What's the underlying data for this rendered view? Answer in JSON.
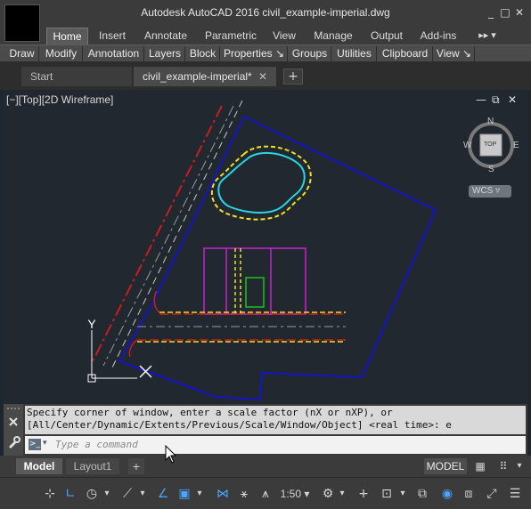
{
  "window": {
    "title": "Autodesk AutoCAD 2016    civil_example-imperial.dwg",
    "controls": [
      "_",
      "□",
      "✕"
    ]
  },
  "ribbon": {
    "tabs": [
      "Home",
      "Insert",
      "Annotate",
      "Parametric",
      "View",
      "Manage",
      "Output",
      "Add-ins"
    ],
    "overflow": "▸▸ ▾",
    "panels": [
      "Draw",
      "Modify",
      "Annotation",
      "Layers",
      "Block",
      "Properties ↘",
      "Groups",
      "Utilities",
      "Clipboard",
      "View ↘"
    ]
  },
  "doc_tabs": {
    "start": "Start",
    "file": "civil_example-imperial*",
    "close": "✕",
    "add": "+"
  },
  "viewport": {
    "label": "[−][Top][2D Wireframe]",
    "controls": [
      "—",
      "⧉",
      "✕"
    ],
    "ucs_y": "Y",
    "viewcube": {
      "n": "N",
      "s": "S",
      "e": "E",
      "w": "W",
      "top": "TOP"
    },
    "wcs": "WCS ▿"
  },
  "command": {
    "history_line1": "Specify corner of window, enter a scale factor (nX or nXP), or",
    "history_line2": "[All/Center/Dynamic/Extents/Previous/Scale/Window/Object] <real time>: e",
    "placeholder": "Type a command",
    "prompt_icon": ">_"
  },
  "layout_tabs": {
    "model": "Model",
    "layout1": "Layout1",
    "add": "+"
  },
  "status": {
    "model": "MODEL",
    "scale": "1:50 ▾",
    "items": [
      "grid",
      "snap",
      "ortho",
      "polar",
      "osnap",
      "otrack",
      "isodraft",
      "annotation-visibility",
      "annotation-scale",
      "workspace",
      "customize"
    ]
  },
  "colors": {
    "boundary": "#1414c8",
    "centerline": "#c81e1e",
    "pond": "#2ad4e0",
    "pond_outline": "#f0e020",
    "building": "#d020d0",
    "structure": "#20c020",
    "road_dash": "#d0d020"
  }
}
